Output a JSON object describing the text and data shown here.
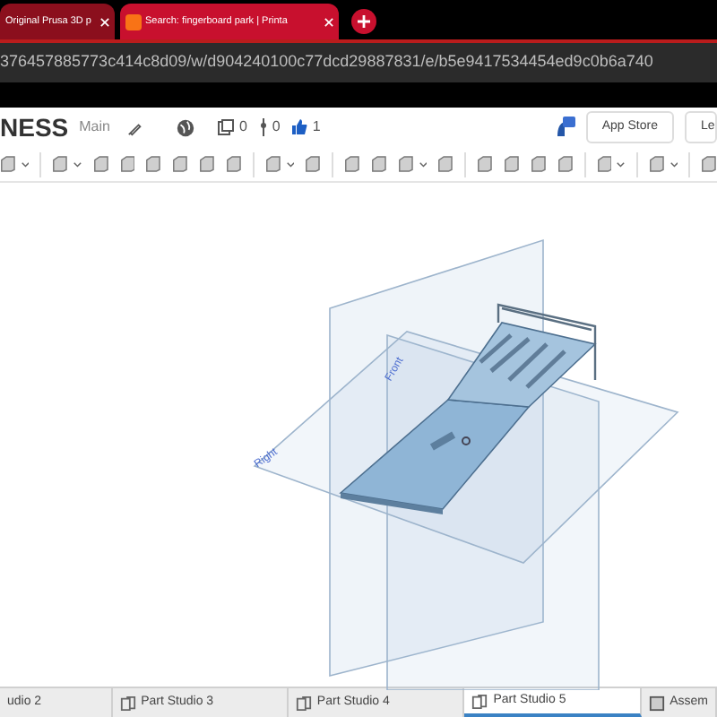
{
  "browser_tabs": [
    {
      "title": "Original Prusa 3D p",
      "selected": false
    },
    {
      "title": "Search: fingerboard park | Printa",
      "selected": true
    }
  ],
  "address": "376457885773c414c8d09/w/d904240100c77dcd29887831/e/b5e9417534454ed9c0b6a740",
  "document": {
    "title": "NESS",
    "branch": "Main",
    "counts": [
      {
        "kind": "versions",
        "value": "0"
      },
      {
        "kind": "branches",
        "value": "0"
      },
      {
        "kind": "likes",
        "value": "1"
      }
    ]
  },
  "header_buttons": [
    "App Store",
    "Le"
  ],
  "plane_labels": [
    "Front",
    "Right"
  ],
  "studio_tabs": [
    {
      "label": "udio 2",
      "kind": "part",
      "selected": false
    },
    {
      "label": "Part Studio 3",
      "kind": "part",
      "selected": false
    },
    {
      "label": "Part Studio 4",
      "kind": "part",
      "selected": false
    },
    {
      "label": "Part Studio 5",
      "kind": "part",
      "selected": true
    },
    {
      "label": "Assem",
      "kind": "assembly",
      "selected": false
    }
  ]
}
